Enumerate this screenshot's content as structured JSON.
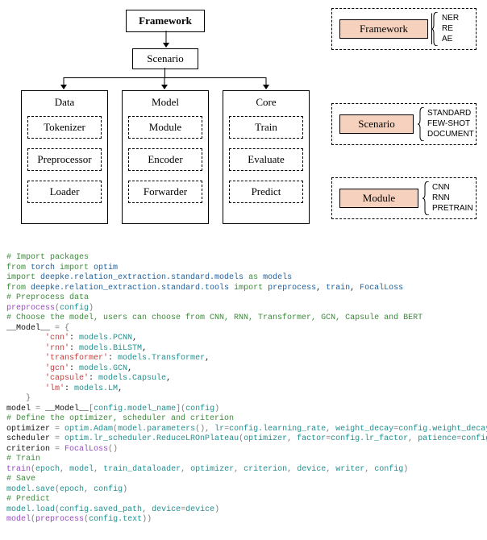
{
  "top": {
    "framework": "Framework",
    "scenario": "Scenario",
    "data": {
      "title": "Data",
      "items": [
        "Tokenizer",
        "Preprocessor",
        "Loader"
      ]
    },
    "model": {
      "title": "Model",
      "items": [
        "Module",
        "Encoder",
        "Forwarder"
      ]
    },
    "core": {
      "title": "Core",
      "items": [
        "Train",
        "Evaluate",
        "Predict"
      ]
    }
  },
  "side": {
    "framework": {
      "title": "Framework",
      "items": [
        "NER",
        "RE",
        "AE"
      ]
    },
    "scenario": {
      "title": "Scenario",
      "items": [
        "STANDARD",
        "FEW-SHOT",
        "DOCUMENT"
      ]
    },
    "module": {
      "title": "Module",
      "items": [
        "CNN",
        "RNN",
        "PRETRAIN"
      ]
    }
  },
  "code": {
    "lines": [
      {
        "parts": [
          {
            "cls": "c-green",
            "t": "# Import packages"
          }
        ]
      },
      {
        "parts": [
          {
            "cls": "c-green",
            "t": "from "
          },
          {
            "cls": "c-blue",
            "t": "torch "
          },
          {
            "cls": "c-green",
            "t": "import "
          },
          {
            "cls": "c-blue",
            "t": "optim"
          }
        ]
      },
      {
        "parts": [
          {
            "cls": "c-green",
            "t": "import "
          },
          {
            "cls": "c-blue",
            "t": "deepke.relation_extraction.standard.models "
          },
          {
            "cls": "c-green",
            "t": "as "
          },
          {
            "cls": "c-blue",
            "t": "models"
          }
        ]
      },
      {
        "parts": [
          {
            "cls": "c-green",
            "t": "from "
          },
          {
            "cls": "c-blue",
            "t": "deepke.relation_extraction.standard.tools "
          },
          {
            "cls": "c-green",
            "t": "import "
          },
          {
            "cls": "c-blue",
            "t": "preprocess"
          },
          {
            "cls": "c-black",
            "t": ", "
          },
          {
            "cls": "c-blue",
            "t": "train"
          },
          {
            "cls": "c-black",
            "t": ", "
          },
          {
            "cls": "c-blue",
            "t": "FocalLoss"
          }
        ]
      },
      {
        "parts": [
          {
            "cls": "c-green",
            "t": "# Preprocess data"
          }
        ]
      },
      {
        "parts": [
          {
            "cls": "c-purple",
            "t": "preprocess"
          },
          {
            "cls": "c-gray",
            "t": "("
          },
          {
            "cls": "c-teal",
            "t": "config"
          },
          {
            "cls": "c-gray",
            "t": ")"
          }
        ]
      },
      {
        "parts": [
          {
            "cls": "c-green",
            "t": "# Choose the model, users can choose from CNN, RNN, Transformer, GCN, Capsule and BERT"
          }
        ]
      },
      {
        "parts": [
          {
            "cls": "c-black",
            "t": "__Model__ "
          },
          {
            "cls": "c-gray",
            "t": "= {"
          }
        ]
      },
      {
        "parts": [
          {
            "cls": "c-black",
            "t": "        "
          },
          {
            "cls": "c-red",
            "t": "'cnn'"
          },
          {
            "cls": "c-black",
            "t": ": "
          },
          {
            "cls": "c-teal",
            "t": "models.PCNN"
          },
          {
            "cls": "c-black",
            "t": ","
          }
        ]
      },
      {
        "parts": [
          {
            "cls": "c-black",
            "t": "        "
          },
          {
            "cls": "c-red",
            "t": "'rnn'"
          },
          {
            "cls": "c-black",
            "t": ": "
          },
          {
            "cls": "c-teal",
            "t": "models.BiLSTM"
          },
          {
            "cls": "c-black",
            "t": ","
          }
        ]
      },
      {
        "parts": [
          {
            "cls": "c-black",
            "t": "        "
          },
          {
            "cls": "c-red",
            "t": "'transformer'"
          },
          {
            "cls": "c-black",
            "t": ": "
          },
          {
            "cls": "c-teal",
            "t": "models.Transformer"
          },
          {
            "cls": "c-black",
            "t": ","
          }
        ]
      },
      {
        "parts": [
          {
            "cls": "c-black",
            "t": "        "
          },
          {
            "cls": "c-red",
            "t": "'gcn'"
          },
          {
            "cls": "c-black",
            "t": ": "
          },
          {
            "cls": "c-teal",
            "t": "models.GCN"
          },
          {
            "cls": "c-black",
            "t": ","
          }
        ]
      },
      {
        "parts": [
          {
            "cls": "c-black",
            "t": "        "
          },
          {
            "cls": "c-red",
            "t": "'capsule'"
          },
          {
            "cls": "c-black",
            "t": ": "
          },
          {
            "cls": "c-teal",
            "t": "models.Capsule"
          },
          {
            "cls": "c-black",
            "t": ","
          }
        ]
      },
      {
        "parts": [
          {
            "cls": "c-black",
            "t": "        "
          },
          {
            "cls": "c-red",
            "t": "'lm'"
          },
          {
            "cls": "c-black",
            "t": ": "
          },
          {
            "cls": "c-teal",
            "t": "models.LM"
          },
          {
            "cls": "c-black",
            "t": ","
          }
        ]
      },
      {
        "parts": [
          {
            "cls": "c-gray",
            "t": "    }"
          }
        ]
      },
      {
        "parts": [
          {
            "cls": "c-black",
            "t": "model "
          },
          {
            "cls": "c-gray",
            "t": "= "
          },
          {
            "cls": "c-black",
            "t": "__Model__"
          },
          {
            "cls": "c-gray",
            "t": "["
          },
          {
            "cls": "c-teal",
            "t": "config.model_name"
          },
          {
            "cls": "c-gray",
            "t": "]("
          },
          {
            "cls": "c-teal",
            "t": "config"
          },
          {
            "cls": "c-gray",
            "t": ")"
          }
        ]
      },
      {
        "parts": [
          {
            "cls": "c-green",
            "t": "# Define the optimizer, scheduler and criterion"
          }
        ]
      },
      {
        "parts": [
          {
            "cls": "c-black",
            "t": "optimizer "
          },
          {
            "cls": "c-gray",
            "t": "= "
          },
          {
            "cls": "c-teal",
            "t": "optim.Adam"
          },
          {
            "cls": "c-gray",
            "t": "("
          },
          {
            "cls": "c-teal",
            "t": "model.parameters"
          },
          {
            "cls": "c-gray",
            "t": "(), "
          },
          {
            "cls": "c-teal",
            "t": "lr"
          },
          {
            "cls": "c-gray",
            "t": "="
          },
          {
            "cls": "c-teal",
            "t": "config.learning_rate"
          },
          {
            "cls": "c-gray",
            "t": ", "
          },
          {
            "cls": "c-teal",
            "t": "weight_decay"
          },
          {
            "cls": "c-gray",
            "t": "="
          },
          {
            "cls": "c-teal",
            "t": "config.weight_decay"
          },
          {
            "cls": "c-gray",
            "t": ")"
          }
        ]
      },
      {
        "parts": [
          {
            "cls": "c-black",
            "t": "scheduler "
          },
          {
            "cls": "c-gray",
            "t": "= "
          },
          {
            "cls": "c-teal",
            "t": "optim.lr_scheduler.ReduceLROnPlateau"
          },
          {
            "cls": "c-gray",
            "t": "("
          },
          {
            "cls": "c-teal",
            "t": "optimizer"
          },
          {
            "cls": "c-gray",
            "t": ", "
          },
          {
            "cls": "c-teal",
            "t": "factor"
          },
          {
            "cls": "c-gray",
            "t": "="
          },
          {
            "cls": "c-teal",
            "t": "config.lr_factor"
          },
          {
            "cls": "c-gray",
            "t": ", "
          },
          {
            "cls": "c-teal",
            "t": "patience"
          },
          {
            "cls": "c-gray",
            "t": "="
          },
          {
            "cls": "c-teal",
            "t": "config.lr_patience"
          },
          {
            "cls": "c-gray",
            "t": ")"
          }
        ]
      },
      {
        "parts": [
          {
            "cls": "c-black",
            "t": "criterion "
          },
          {
            "cls": "c-gray",
            "t": "= "
          },
          {
            "cls": "c-purple",
            "t": "FocalLoss"
          },
          {
            "cls": "c-gray",
            "t": "()"
          }
        ]
      },
      {
        "parts": [
          {
            "cls": "c-green",
            "t": "# Train"
          }
        ]
      },
      {
        "parts": [
          {
            "cls": "c-purple",
            "t": "train"
          },
          {
            "cls": "c-gray",
            "t": "("
          },
          {
            "cls": "c-teal",
            "t": "epoch"
          },
          {
            "cls": "c-gray",
            "t": ", "
          },
          {
            "cls": "c-teal",
            "t": "model"
          },
          {
            "cls": "c-gray",
            "t": ", "
          },
          {
            "cls": "c-teal",
            "t": "train_dataloader"
          },
          {
            "cls": "c-gray",
            "t": ", "
          },
          {
            "cls": "c-teal",
            "t": "optimizer"
          },
          {
            "cls": "c-gray",
            "t": ", "
          },
          {
            "cls": "c-teal",
            "t": "criterion"
          },
          {
            "cls": "c-gray",
            "t": ", "
          },
          {
            "cls": "c-teal",
            "t": "device"
          },
          {
            "cls": "c-gray",
            "t": ", "
          },
          {
            "cls": "c-teal",
            "t": "writer"
          },
          {
            "cls": "c-gray",
            "t": ", "
          },
          {
            "cls": "c-teal",
            "t": "config"
          },
          {
            "cls": "c-gray",
            "t": ")"
          }
        ]
      },
      {
        "parts": [
          {
            "cls": "c-green",
            "t": "# Save"
          }
        ]
      },
      {
        "parts": [
          {
            "cls": "c-teal",
            "t": "model.save"
          },
          {
            "cls": "c-gray",
            "t": "("
          },
          {
            "cls": "c-teal",
            "t": "epoch"
          },
          {
            "cls": "c-gray",
            "t": ", "
          },
          {
            "cls": "c-teal",
            "t": "config"
          },
          {
            "cls": "c-gray",
            "t": ")"
          }
        ]
      },
      {
        "parts": [
          {
            "cls": "c-green",
            "t": "# Predict"
          }
        ]
      },
      {
        "parts": [
          {
            "cls": "c-teal",
            "t": "model.load"
          },
          {
            "cls": "c-gray",
            "t": "("
          },
          {
            "cls": "c-teal",
            "t": "config.saved_path"
          },
          {
            "cls": "c-gray",
            "t": ", "
          },
          {
            "cls": "c-teal",
            "t": "device"
          },
          {
            "cls": "c-gray",
            "t": "="
          },
          {
            "cls": "c-teal",
            "t": "device"
          },
          {
            "cls": "c-gray",
            "t": ")"
          }
        ]
      },
      {
        "parts": [
          {
            "cls": "c-purple",
            "t": "model"
          },
          {
            "cls": "c-gray",
            "t": "("
          },
          {
            "cls": "c-purple",
            "t": "preprocess"
          },
          {
            "cls": "c-gray",
            "t": "("
          },
          {
            "cls": "c-teal",
            "t": "config.text"
          },
          {
            "cls": "c-gray",
            "t": "))"
          }
        ]
      }
    ]
  }
}
